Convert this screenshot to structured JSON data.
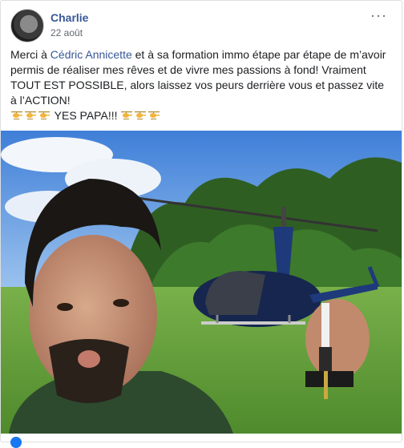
{
  "post": {
    "author": "Charlie",
    "date": "22 août",
    "menu": "···",
    "text_before_link": "Merci à ",
    "link": "Cédric Annicette",
    "text_after_link": " et à sa formation immo étape par étape de m’avoir permis de réaliser mes rêves et de vivre mes passions à fond! Vraiment TOUT EST POSSIBLE, alors laissez vos peurs derrière vous et passez vite à l’ACTION!",
    "emoji_name": "helicopter-emoji",
    "slogan": "YES PAPA!!!"
  },
  "photo": {
    "description_icon": "helicopter-selfie-photo"
  }
}
